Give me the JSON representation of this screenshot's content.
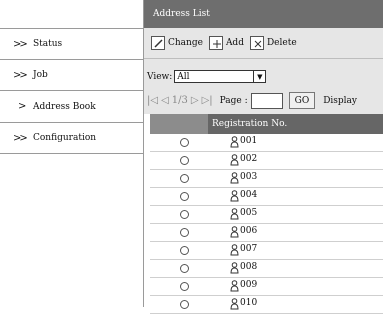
{
  "sidebar": {
    "items": [
      {
        "label": "Status",
        "chevron": "double"
      },
      {
        "label": "Job",
        "chevron": "double"
      },
      {
        "label": "Address Book",
        "chevron": "single"
      },
      {
        "label": "Configuration",
        "chevron": "double"
      }
    ]
  },
  "main": {
    "title": "Address List",
    "toolbar": {
      "change": "Change",
      "add": "Add",
      "delete": "Delete"
    },
    "view_label": "View:",
    "view_value": "All",
    "pager": {
      "page_info": "1/3",
      "page_label": "Page :",
      "go": "GO",
      "display": "Display"
    },
    "table": {
      "header": "Registration No.",
      "rows": [
        "001",
        "002",
        "003",
        "004",
        "005",
        "006",
        "007",
        "008",
        "009",
        "010"
      ]
    }
  }
}
